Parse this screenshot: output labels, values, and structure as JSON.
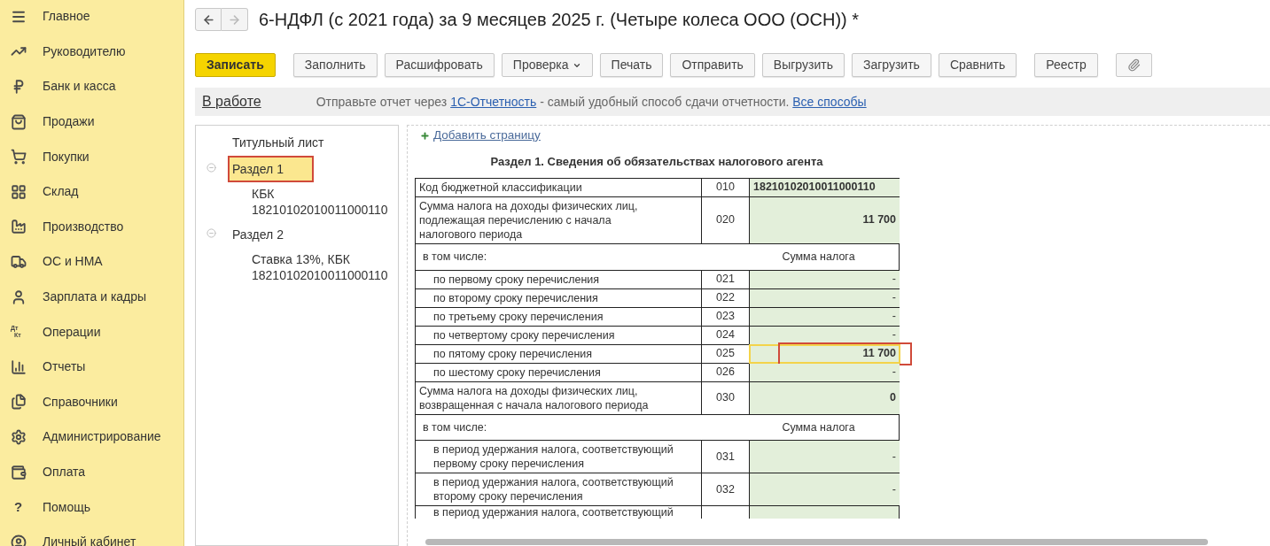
{
  "sidebar": {
    "items": [
      {
        "label": "Главное"
      },
      {
        "label": "Руководителю"
      },
      {
        "label": "Банк и касса"
      },
      {
        "label": "Продажи"
      },
      {
        "label": "Покупки"
      },
      {
        "label": "Склад"
      },
      {
        "label": "Производство"
      },
      {
        "label": "ОС и НМА"
      },
      {
        "label": "Зарплата и кадры"
      },
      {
        "label": "Операции",
        "glyph": [
          "Дт",
          "Кт"
        ]
      },
      {
        "label": "Отчеты"
      },
      {
        "label": "Справочники"
      },
      {
        "label": "Администрирование"
      },
      {
        "label": "Оплата"
      },
      {
        "label": "Помощь",
        "glyph": [
          "?"
        ]
      },
      {
        "label": "Личный кабинет"
      }
    ]
  },
  "window": {
    "title": "6-НДФЛ (с 2021 года) за 9 месяцев 2025 г. (Четыре колеса ООО (ОСН)) *"
  },
  "toolbar": {
    "groups": [
      [
        {
          "label": "Записать",
          "kind": "primary"
        }
      ],
      [
        {
          "label": "Заполнить",
          "kind": "default"
        },
        {
          "label": "Расшифровать",
          "kind": "default"
        },
        {
          "label": "Проверка",
          "kind": "dropdown"
        },
        {
          "label": "Печать",
          "kind": "default"
        },
        {
          "label": "Отправить",
          "kind": "default"
        },
        {
          "label": "Выгрузить",
          "kind": "default"
        },
        {
          "label": "Загрузить",
          "kind": "default"
        },
        {
          "label": "Сравнить",
          "kind": "default"
        }
      ],
      [
        {
          "label": "Реестр",
          "kind": "default"
        }
      ],
      [
        {
          "kind": "attach"
        }
      ]
    ]
  },
  "info_bar": {
    "status": "В работе",
    "message": [
      {
        "kind": "text",
        "text": "Отправьте отчет через "
      },
      {
        "kind": "link",
        "text": "1С-Отчетность"
      },
      {
        "kind": "text",
        "text": " - самый удобный способ сдачи отчетности. "
      },
      {
        "kind": "link",
        "text": "Все способы"
      }
    ]
  },
  "tree": {
    "items": [
      {
        "label": "Титульный лист",
        "selected": false,
        "marked": false
      },
      {
        "label": "Раздел 1",
        "expanded": true,
        "selected": true,
        "marked": true,
        "children": [
          {
            "label": "КБК 18210102010011000110",
            "selected": false,
            "marked": false
          }
        ]
      },
      {
        "label": "Раздел 2",
        "expanded": true,
        "selected": false,
        "marked": false,
        "children": [
          {
            "label": "Ставка 13%, КБК 18210102010011000110",
            "selected": false,
            "marked": false
          }
        ]
      }
    ]
  },
  "form": {
    "add_page": "Добавить страницу",
    "heading": "Раздел 1. Сведения об обязательствах налогового агента",
    "rows": [
      {
        "kind": "code",
        "label": "Код бюджетной классификации",
        "code": "010",
        "value": "18210102010011000110",
        "selected": false,
        "marked": false
      },
      {
        "kind": "field",
        "label": "Сумма налога на доходы физических лиц, подлежащая перечислению с начала налогового периода",
        "code": "020",
        "value": "11 700",
        "selected": false,
        "marked": false
      },
      {
        "kind": "subheader",
        "label": "в том числе:",
        "value": "Сумма налога"
      },
      {
        "kind": "subfield",
        "label": "по первому сроку перечисления",
        "code": "021",
        "value": "-",
        "selected": false,
        "marked": false
      },
      {
        "kind": "subfield",
        "label": "по второму сроку перечисления",
        "code": "022",
        "value": "-",
        "selected": false,
        "marked": false
      },
      {
        "kind": "subfield",
        "label": "по третьему сроку перечисления",
        "code": "023",
        "value": "-",
        "selected": false,
        "marked": false
      },
      {
        "kind": "subfield",
        "label": "по четвертому сроку перечисления",
        "code": "024",
        "value": "-",
        "selected": false,
        "marked": false
      },
      {
        "kind": "subfield",
        "label": "по пятому сроку перечисления",
        "code": "025",
        "value": "11 700",
        "selected": true,
        "marked": true
      },
      {
        "kind": "subfield",
        "label": "по шестому сроку перечисления",
        "code": "026",
        "value": "-",
        "selected": false,
        "marked": false
      },
      {
        "kind": "field",
        "label": "Сумма налога на доходы физических лиц, возвращенная с начала налогового периода",
        "code": "030",
        "value": "0",
        "selected": false,
        "marked": false
      },
      {
        "kind": "subheader",
        "label": "в том числе:",
        "value": "Сумма налога"
      },
      {
        "kind": "subfield",
        "label": "в период удержания налога, соответствующий первому сроку перечисления",
        "code": "031",
        "value": "-",
        "selected": false,
        "marked": false
      },
      {
        "kind": "subfield",
        "label": "в период удержания налога, соответствующий второму сроку перечисления",
        "code": "032",
        "value": "-",
        "selected": false,
        "marked": false
      },
      {
        "kind": "partial",
        "label": "в период удержания налога, соответствующий"
      }
    ]
  }
}
